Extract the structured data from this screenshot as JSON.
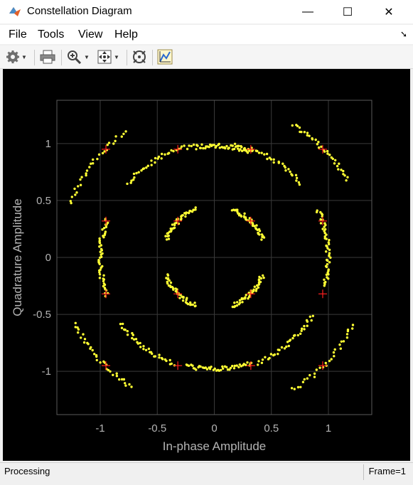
{
  "window": {
    "title": "Constellation Diagram",
    "icon": "matlab-logo-icon",
    "controls": {
      "minimize": "—",
      "maximize": "☐",
      "close": "✕"
    }
  },
  "menu": {
    "items": [
      "File",
      "Tools",
      "View",
      "Help"
    ],
    "dock_icon": "dock-arrow-icon"
  },
  "toolbar": {
    "tools": [
      "settings-icon",
      "print-icon",
      "zoom-in-icon",
      "zoom-fit-icon",
      "reference-constellation-icon",
      "measurement-icon"
    ]
  },
  "status": {
    "left": "Processing",
    "right": "Frame=1"
  },
  "colors": {
    "plot_background": "#000000",
    "axes_background": "#000000",
    "grid": "#3a3a3a",
    "data": "#ffff33",
    "reference": "#ff2020",
    "tick_text": "#b4b4b4"
  },
  "chart_data": {
    "type": "scatter",
    "title": "",
    "xlabel": "In-phase Amplitude",
    "ylabel": "Quadrature Amplitude",
    "xlim": [
      -1.38,
      1.38
    ],
    "ylim": [
      -1.38,
      1.38
    ],
    "xticks": [
      -1,
      -0.5,
      0,
      0.5,
      1
    ],
    "yticks": [
      -1,
      -0.5,
      0,
      0.5,
      1
    ],
    "xtick_labels": [
      "-1",
      "-0.5",
      "0",
      "0.5",
      "1"
    ],
    "ytick_labels": [
      "-1",
      "-0.5",
      "0",
      "0.5",
      "1"
    ],
    "grid": true,
    "reference_points": [
      [
        -0.95,
        0.95
      ],
      [
        -0.32,
        0.95
      ],
      [
        0.32,
        0.95
      ],
      [
        0.95,
        0.95
      ],
      [
        -0.95,
        0.32
      ],
      [
        -0.32,
        0.32
      ],
      [
        0.32,
        0.32
      ],
      [
        0.95,
        0.32
      ],
      [
        -0.95,
        -0.32
      ],
      [
        -0.32,
        -0.32
      ],
      [
        0.32,
        -0.32
      ],
      [
        0.95,
        -0.32
      ],
      [
        -0.95,
        -0.95
      ],
      [
        -0.32,
        -0.95
      ],
      [
        0.32,
        -0.95
      ],
      [
        0.95,
        -0.95
      ]
    ],
    "received_arcs": [
      {
        "radius": 0.45,
        "from_deg": 20,
        "to_deg": 70,
        "count": 40
      },
      {
        "radius": 0.45,
        "from_deg": 110,
        "to_deg": 160,
        "count": 40
      },
      {
        "radius": 0.45,
        "from_deg": 200,
        "to_deg": 250,
        "count": 40
      },
      {
        "radius": 0.45,
        "from_deg": 290,
        "to_deg": 340,
        "count": 40
      },
      {
        "radius": 0.98,
        "from_deg": 70,
        "to_deg": 100,
        "count": 45
      },
      {
        "radius": 1.0,
        "from_deg": 100,
        "to_deg": 140,
        "count": 35
      },
      {
        "radius": 1.0,
        "from_deg": 160,
        "to_deg": 200,
        "count": 50
      },
      {
        "radius": 1.0,
        "from_deg": 215,
        "to_deg": 250,
        "count": 35
      },
      {
        "radius": 0.98,
        "from_deg": 255,
        "to_deg": 290,
        "count": 45
      },
      {
        "radius": 1.0,
        "from_deg": 292,
        "to_deg": 330,
        "count": 35
      },
      {
        "radius": 1.0,
        "from_deg": 345,
        "to_deg": 385,
        "count": 50
      },
      {
        "radius": 1.0,
        "from_deg": 400,
        "to_deg": 440,
        "count": 35
      },
      {
        "radius": 1.35,
        "from_deg": 30,
        "to_deg": 60,
        "count": 35
      },
      {
        "radius": 1.35,
        "from_deg": 125,
        "to_deg": 160,
        "count": 30
      },
      {
        "radius": 1.35,
        "from_deg": 205,
        "to_deg": 238,
        "count": 35
      },
      {
        "radius": 1.35,
        "from_deg": 300,
        "to_deg": 335,
        "count": 30
      }
    ]
  }
}
